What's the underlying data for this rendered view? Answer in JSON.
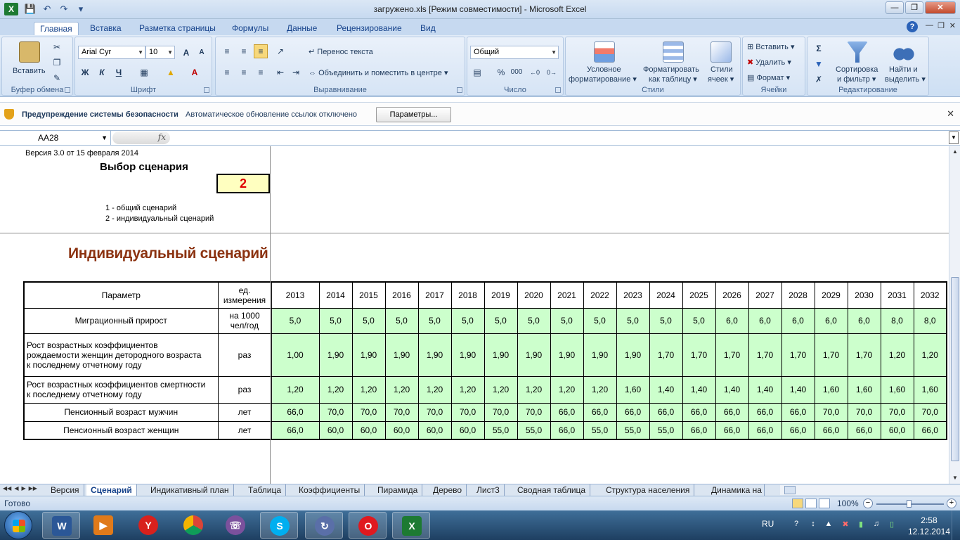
{
  "window": {
    "title": "загружено.xls  [Режим совместимости] - Microsoft Excel",
    "app_icon": "X"
  },
  "ribbon": {
    "tabs": [
      "Главная",
      "Вставка",
      "Разметка страницы",
      "Формулы",
      "Данные",
      "Рецензирование",
      "Вид"
    ],
    "active_tab": "Главная",
    "clipboard": {
      "paste": "Вставить",
      "group": "Буфер обмена"
    },
    "font": {
      "name": "Arial Cyr",
      "size": "10",
      "group": "Шрифт",
      "bold": "Ж",
      "italic": "К",
      "underline": "Ч"
    },
    "alignment": {
      "wrap": "Перенос текста",
      "merge": "Объединить и поместить в центре",
      "group": "Выравнивание"
    },
    "number": {
      "format": "Общий",
      "percent": "%",
      "thousands": "000",
      "group": "Число"
    },
    "styles": {
      "conditional_1": "Условное",
      "conditional_2": "форматирование",
      "as_table_1": "Форматировать",
      "as_table_2": "как таблицу",
      "cell_styles_1": "Стили",
      "cell_styles_2": "ячеек",
      "group": "Стили"
    },
    "cells": {
      "insert": "Вставить",
      "delete": "Удалить",
      "format": "Формат",
      "group": "Ячейки"
    },
    "editing": {
      "sort_1": "Сортировка",
      "sort_2": "и фильтр",
      "find_1": "Найти и",
      "find_2": "выделить",
      "group": "Редактирование"
    }
  },
  "security_bar": {
    "title": "Предупреждение системы безопасности",
    "message": "Автоматическое обновление ссылок отключено",
    "button": "Параметры..."
  },
  "formula_bar": {
    "name_box": "AA28",
    "fx": "fx",
    "formula": ""
  },
  "sheet": {
    "version": "Версия 3.0 от 15 февраля 2014",
    "scenario_title": "Выбор сценария",
    "scenario_value": "2",
    "option_1": "1 - общий сценарий",
    "option_2": "2 - индивидуальный сценарий",
    "section_title": "Индивидуальный сценарий",
    "table": {
      "param_header": "Параметр",
      "unit_header_1": "ед.",
      "unit_header_2": "измерения",
      "years": [
        "2013",
        "2014",
        "2015",
        "2016",
        "2017",
        "2018",
        "2019",
        "2020",
        "2021",
        "2022",
        "2023",
        "2024",
        "2025",
        "2026",
        "2027",
        "2028",
        "2029",
        "2030",
        "2031",
        "2032"
      ],
      "rows": [
        {
          "param": "Миграционный прирост",
          "unit_1": "на 1000",
          "unit_2": "чел/год",
          "values": [
            "5,0",
            "5,0",
            "5,0",
            "5,0",
            "5,0",
            "5,0",
            "5,0",
            "5,0",
            "5,0",
            "5,0",
            "5,0",
            "5,0",
            "5,0",
            "6,0",
            "6,0",
            "6,0",
            "6,0",
            "6,0",
            "8,0",
            "8,0"
          ]
        },
        {
          "param_1": "Рост возрастных коэффициентов",
          "param_2": "рождаемости женщин детородного возраста",
          "param_3": "к последнему отчетному году",
          "unit": "раз",
          "values": [
            "1,00",
            "1,90",
            "1,90",
            "1,90",
            "1,90",
            "1,90",
            "1,90",
            "1,90",
            "1,90",
            "1,90",
            "1,90",
            "1,70",
            "1,70",
            "1,70",
            "1,70",
            "1,70",
            "1,70",
            "1,70",
            "1,20",
            "1,20"
          ]
        },
        {
          "param_1": "Рост возрастных коэффициентов смертности",
          "param_2": "к последнему отчетному году",
          "unit": "раз",
          "values": [
            "1,20",
            "1,20",
            "1,20",
            "1,20",
            "1,20",
            "1,20",
            "1,20",
            "1,20",
            "1,20",
            "1,20",
            "1,60",
            "1,40",
            "1,40",
            "1,40",
            "1,40",
            "1,40",
            "1,60",
            "1,60",
            "1,60",
            "1,60"
          ]
        },
        {
          "param": "Пенсионный возраст мужчин",
          "unit": "лет",
          "values": [
            "66,0",
            "70,0",
            "70,0",
            "70,0",
            "70,0",
            "70,0",
            "70,0",
            "70,0",
            "66,0",
            "66,0",
            "66,0",
            "66,0",
            "66,0",
            "66,0",
            "66,0",
            "66,0",
            "70,0",
            "70,0",
            "70,0",
            "70,0"
          ]
        },
        {
          "param": "Пенсионный возраст женщин",
          "unit": "лет",
          "values": [
            "66,0",
            "60,0",
            "60,0",
            "60,0",
            "60,0",
            "60,0",
            "55,0",
            "55,0",
            "66,0",
            "55,0",
            "55,0",
            "55,0",
            "66,0",
            "66,0",
            "66,0",
            "66,0",
            "66,0",
            "66,0",
            "60,0",
            "66,0"
          ]
        }
      ]
    }
  },
  "sheet_tabs": [
    "Версия",
    "Сценарий",
    "Индикативный план",
    "Таблица",
    "Коэффициенты",
    "Пирамида",
    "Дерево",
    "Лист3",
    "Сводная таблица",
    "Структура населения",
    "Динамика на"
  ],
  "active_sheet": "Сценарий",
  "status": {
    "ready": "Готово",
    "zoom": "100%"
  },
  "taskbar": {
    "apps": [
      "word-icon",
      "media-player-icon",
      "yandex-browser-icon",
      "chrome-icon",
      "viber-icon",
      "skype-icon",
      "torrent-icon",
      "opera-icon",
      "excel-icon"
    ],
    "lang": "RU",
    "time": "2:58",
    "date": "12.12.2014"
  },
  "colors": {
    "input_fill": "#ccffcc",
    "scenario_fill": "#ffffc0",
    "scenario_value": "#e00000",
    "section_title": "#8b3210"
  }
}
